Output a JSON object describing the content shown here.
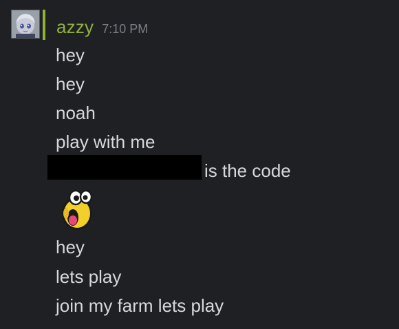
{
  "user": {
    "name": "azzy",
    "time": "7:10 PM",
    "status_color": "#8fb23a",
    "avatar_icon": "anime-character-avatar"
  },
  "messages": [
    {
      "text": "hey"
    },
    {
      "text": "hey"
    },
    {
      "text": "noah"
    },
    {
      "text": "play with me"
    },
    {
      "text": "is the code",
      "redacted_prefix": true
    },
    {
      "emoji": "screaming-yellow-blob-emoji"
    },
    {
      "text": "hey"
    },
    {
      "text": "lets play"
    },
    {
      "text": "join my farm lets play"
    }
  ],
  "colors": {
    "background": "#1f2024",
    "message_text": "#d7d8da",
    "username": "#8fb23a",
    "timestamp": "#7b7e84"
  }
}
